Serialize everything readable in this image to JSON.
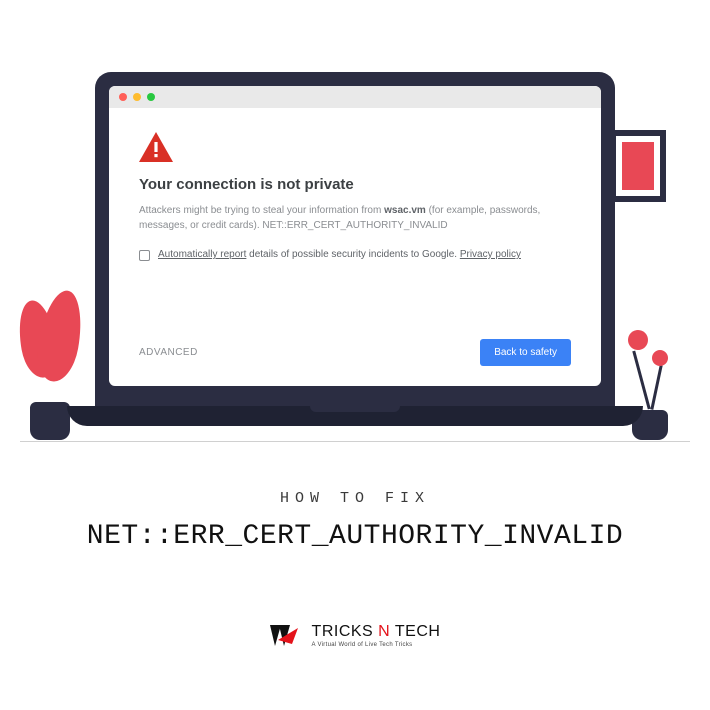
{
  "browser": {
    "warning_heading": "Your connection is not private",
    "desc_before": "Attackers might be trying to steal your information from ",
    "desc_domain": "wsac.vm",
    "desc_after": " (for example, passwords, messages, or credit cards). ",
    "error_code": "NET::ERR_CERT_AUTHORITY_INVALID",
    "report_link": "Automatically report",
    "report_rest": " details of possible security incidents to Google. ",
    "privacy_link": "Privacy policy",
    "advanced_label": "ADVANCED",
    "safety_button": "Back to safety"
  },
  "title": {
    "overline": "HOW TO FIX",
    "main": "NET::ERR_CERT_AUTHORITY_INVALID"
  },
  "footer": {
    "brand_tricks": "TRICKS ",
    "brand_n": "N",
    "brand_tech": " TECH",
    "tagline": "A Virtual World of Live Tech Tricks"
  }
}
